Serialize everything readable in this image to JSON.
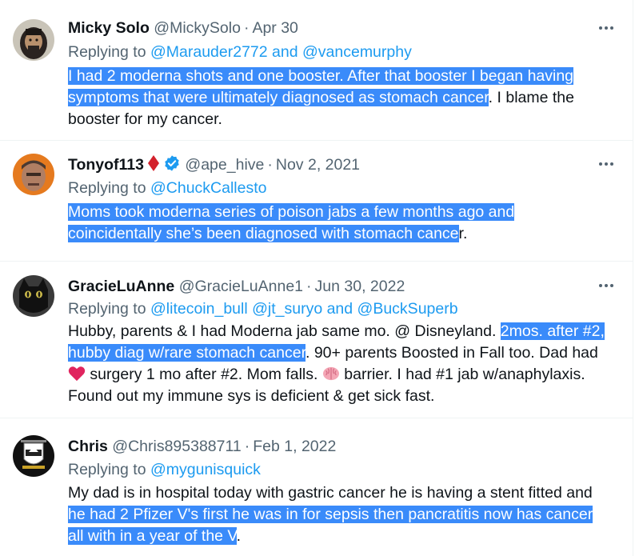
{
  "colors": {
    "highlight": "#3a8bfa",
    "link": "#1d9bf0",
    "muted": "#536471",
    "text": "#0f1419",
    "divider": "#eff3f4",
    "verified": "#1d9bf0",
    "diamond": "#d3212c",
    "heart": "#e0245e"
  },
  "tweets": [
    {
      "name": "Micky Solo",
      "handle": "@MickySolo",
      "date": "Apr 30",
      "reply_prefix": "Replying to",
      "reply_to": "@Marauder2772 and @vancemurphy",
      "text_highlight": "I had 2 moderna shots and one booster. After that booster I began having symptoms that were ultimately diagnosed as stomach cancer",
      "text_after": ". I blame the booster for my cancer."
    },
    {
      "name": "Tonyof113",
      "name_badge_icon": "red-diamond-icon",
      "verified_icon": "verified-badge-icon",
      "handle": "@ape_hive",
      "date": "Nov 2, 2021",
      "reply_prefix": "Replying to",
      "reply_to": "@ChuckCallesto",
      "text_highlight": "Moms took moderna series of poison jabs a few months ago and coincidentally she’s been diagnosed with stomach cance",
      "text_after": "r."
    },
    {
      "name": "GracieLuAnne",
      "handle": "@GracieLuAnne1",
      "date": "Jun 30, 2022",
      "reply_prefix": "Replying to",
      "reply_to": "@litecoin_bull @jt_suryo and @BuckSuperb",
      "text_before": "Hubby, parents & I had Moderna jab same mo. @ Disneyland. ",
      "text_highlight": "2mos. after #2, hubby diag w/rare stomach cancer",
      "text_mid": ". 90+ parents Boosted in Fall too. Dad had ",
      "emoji_1": "red-heart-emoji",
      "text_mid2": " surgery 1 mo after #2. Mom falls. ",
      "emoji_2": "brain-emoji",
      "text_after": " barrier. I had #1 jab w/anaphylaxis. Found out my immune sys is deficient & get sick fast."
    },
    {
      "name": "Chris",
      "handle": "@Chris895388711",
      "date": "Feb 1, 2022",
      "reply_prefix": "Replying to",
      "reply_to": "@mygunisquick",
      "text_before": "My dad is in hospital today with gastric cancer he is having a stent fitted and ",
      "text_highlight": "he had 2 Pfizer V's first he was in for sepsis then pancratitis now has cancer all with in a year of the V",
      "text_after": "."
    }
  ],
  "separator": "·"
}
